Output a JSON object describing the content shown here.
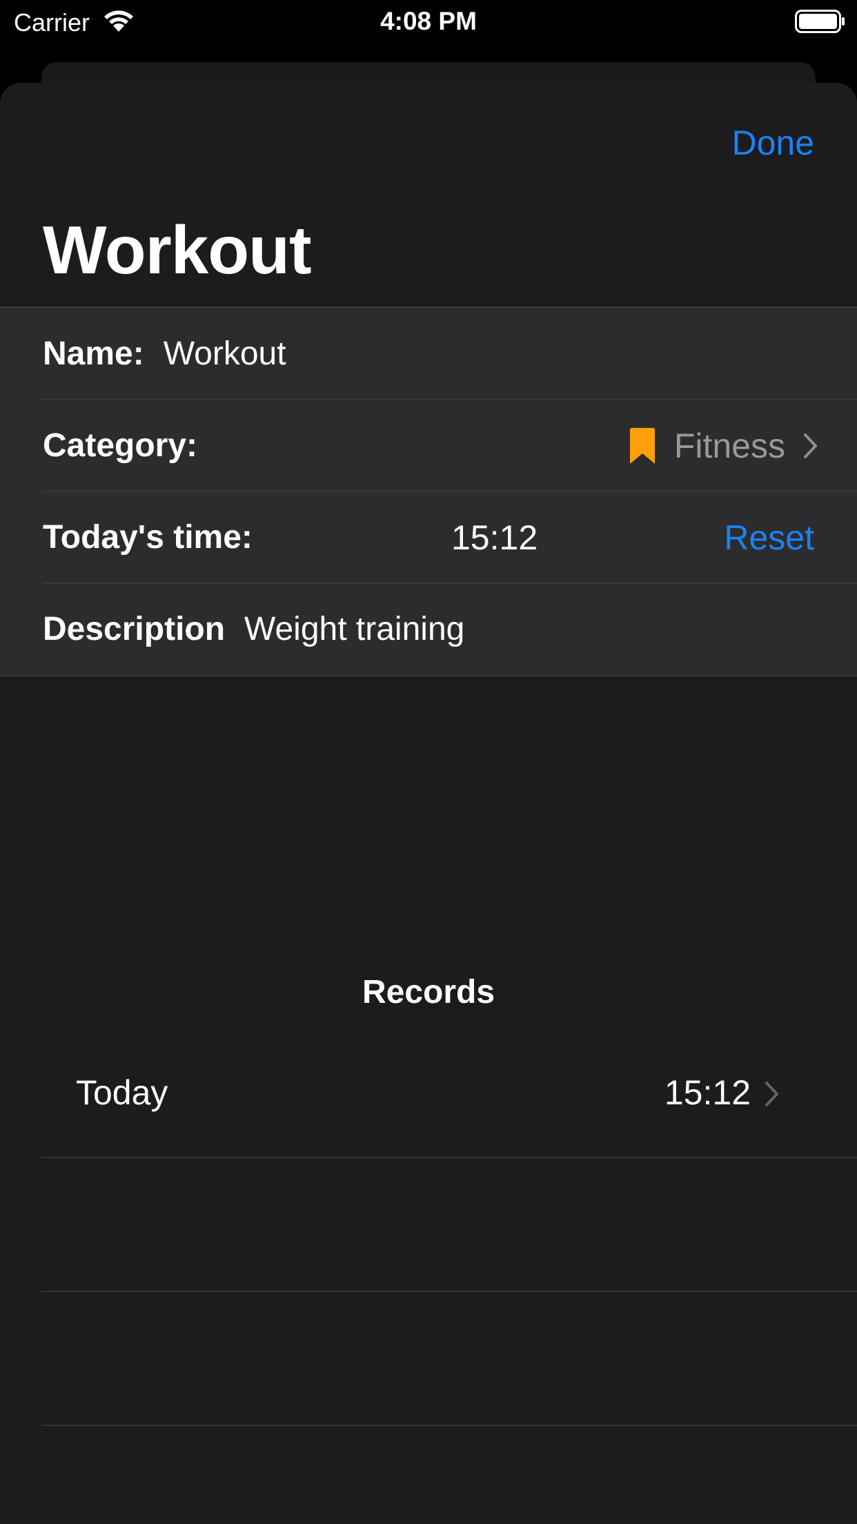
{
  "status_bar": {
    "carrier": "Carrier",
    "time": "4:08 PM"
  },
  "header": {
    "done_label": "Done",
    "title": "Workout"
  },
  "form": {
    "name_label": "Name:",
    "name_value": "Workout",
    "category_label": "Category:",
    "category_value": "Fitness",
    "category_icon": "bookmark-icon",
    "category_color": "#FF9F0A",
    "time_label": "Today's time:",
    "time_value": "15:12",
    "reset_label": "Reset",
    "description_label": "Description",
    "description_value": "Weight training"
  },
  "records": {
    "title": "Records",
    "items": [
      {
        "label": "Today",
        "value": "15:12"
      }
    ]
  },
  "colors": {
    "accent": "#1A82F0",
    "background": "#1C1C1E",
    "group_background": "#2C2C2E"
  }
}
